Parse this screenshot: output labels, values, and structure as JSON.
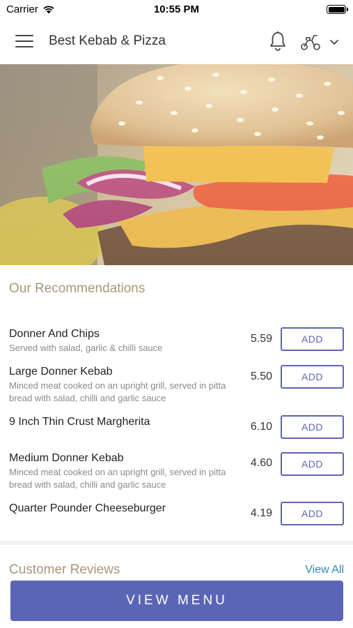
{
  "status_bar": {
    "carrier": "Carrier",
    "time": "10:55 PM"
  },
  "header": {
    "title": "Best Kebab & Pizza"
  },
  "recommendations": {
    "title": "Our Recommendations",
    "add_label": "ADD",
    "items": [
      {
        "name": "Donner And Chips",
        "description": "Served with salad, garlic & chilli sauce",
        "price": "5.59"
      },
      {
        "name": "Large Donner Kebab",
        "description": "Minced meat cooked on an upright grill, served in pitta bread with salad, chilli and garlic sauce",
        "price": "5.50"
      },
      {
        "name": "9 Inch Thin Crust Margherita",
        "description": "",
        "price": "6.10"
      },
      {
        "name": "Medium Donner Kebab",
        "description": "Minced meat cooked on an upright grill, served in pitta bread with salad, chilli and garlic sauce",
        "price": "4.60"
      },
      {
        "name": "Quarter Pounder Cheeseburger",
        "description": "",
        "price": "4.19"
      }
    ]
  },
  "reviews": {
    "title": "Customer Reviews",
    "view_all": "View All"
  },
  "footer": {
    "view_menu": "VIEW MENU"
  },
  "colors": {
    "accent": "#5b65b5",
    "section_title": "#a8987a",
    "link": "#2f86b8"
  },
  "icons": [
    "menu-icon",
    "bell-icon",
    "scooter-icon",
    "chevron-down-icon",
    "wifi-icon",
    "battery-icon"
  ]
}
